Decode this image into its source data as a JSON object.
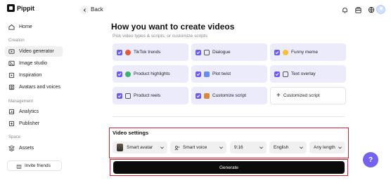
{
  "app": {
    "brand": "Pippit"
  },
  "sidebar": {
    "items": [
      {
        "label": "Home",
        "icon": "home-icon"
      },
      {
        "label": "Video generator",
        "icon": "video-icon"
      },
      {
        "label": "Image studio",
        "icon": "image-icon"
      },
      {
        "label": "Inspiration",
        "icon": "inspiration-icon"
      },
      {
        "label": "Avatars and voices",
        "icon": "avatar-icon"
      },
      {
        "label": "Analytics",
        "icon": "analytics-icon"
      },
      {
        "label": "Publisher",
        "icon": "publisher-icon"
      },
      {
        "label": "Assets",
        "icon": "assets-icon"
      }
    ],
    "sections": {
      "creation": "Creation",
      "management": "Management",
      "space": "Space"
    },
    "invite": "Invite friends"
  },
  "topbar": {
    "back_label": "Back"
  },
  "main": {
    "title": "How you want to create videos",
    "subtitle": "Pick video types & scripts, or customize scripts",
    "video_types": [
      {
        "label": "TikTok trends",
        "checked": true,
        "emoji_color": "#e8573b"
      },
      {
        "label": "Dialogue",
        "checked": true,
        "emoji_color": ""
      },
      {
        "label": "Funny meme",
        "checked": true,
        "emoji_color": "#f5c02f"
      },
      {
        "label": "Product highlights",
        "checked": true,
        "emoji_color": "#3bb36b"
      },
      {
        "label": "Plot twist",
        "checked": true,
        "emoji_color": ""
      },
      {
        "label": "Text overlay",
        "checked": true,
        "emoji_color": ""
      },
      {
        "label": "Product reels",
        "checked": true,
        "emoji_color": ""
      },
      {
        "label": "Customize script",
        "checked": true,
        "emoji_color": "#d88a3c"
      },
      {
        "label": "Customized script",
        "checked": false,
        "emoji_color": ""
      }
    ],
    "settings": {
      "title": "Video settings",
      "avatar": "Smart avatar",
      "voice": "Smart voice",
      "ratio": "9:16",
      "language": "English",
      "length": "Any length"
    },
    "generate_label": "Generate"
  },
  "colors": {
    "accent": "#6a5cf0",
    "highlight": "#d8212f",
    "card_bg": "#ecebfc"
  }
}
